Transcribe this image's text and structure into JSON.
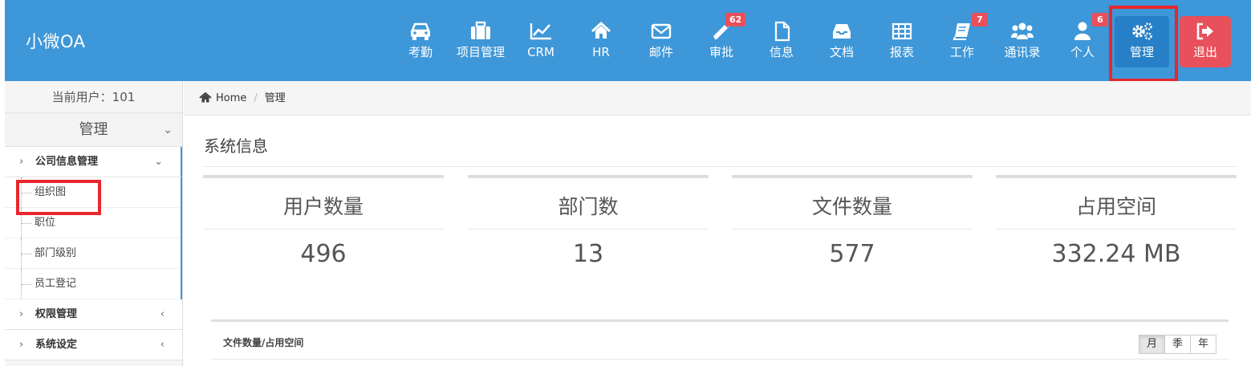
{
  "brand": "小微OA",
  "nav": [
    {
      "label": "考勤",
      "icon": "car-icon"
    },
    {
      "label": "项目管理",
      "icon": "briefcase-icon"
    },
    {
      "label": "CRM",
      "icon": "line-chart-icon"
    },
    {
      "label": "HR",
      "icon": "home-icon"
    },
    {
      "label": "邮件",
      "icon": "envelope-icon"
    },
    {
      "label": "审批",
      "icon": "pencil-icon",
      "badge": "62"
    },
    {
      "label": "信息",
      "icon": "file-icon"
    },
    {
      "label": "文档",
      "icon": "inbox-icon"
    },
    {
      "label": "报表",
      "icon": "table-icon"
    },
    {
      "label": "工作",
      "icon": "book-icon",
      "badge": "7"
    },
    {
      "label": "通讯录",
      "icon": "users-icon"
    },
    {
      "label": "个人",
      "icon": "user-icon",
      "badge": "6"
    },
    {
      "label": "管理",
      "icon": "gears-icon"
    },
    {
      "label": "退出",
      "icon": "sign-out-icon"
    }
  ],
  "sidebar": {
    "current_user": "当前用户：101",
    "section": "管理",
    "groups": [
      {
        "label": "公司信息管理",
        "items": [
          "组织图",
          "职位",
          "部门级别",
          "员工登记"
        ]
      },
      {
        "label": "权限管理"
      },
      {
        "label": "系统设定"
      }
    ]
  },
  "breadcrumb": {
    "home": "Home",
    "current": "管理"
  },
  "main": {
    "title": "系统信息",
    "stats": [
      {
        "label": "用户数量",
        "value": "496"
      },
      {
        "label": "部门数",
        "value": "13"
      },
      {
        "label": "文件数量",
        "value": "577"
      },
      {
        "label": "占用空间",
        "value": "332.24 MB"
      }
    ],
    "panel": {
      "title": "文件数量/占用空间",
      "buttons": [
        "月",
        "季",
        "年"
      ]
    }
  },
  "colors": {
    "topbar": "#3e97d8",
    "active": "#2780c7",
    "danger": "#e8505b",
    "highlight": "#e8262c"
  }
}
